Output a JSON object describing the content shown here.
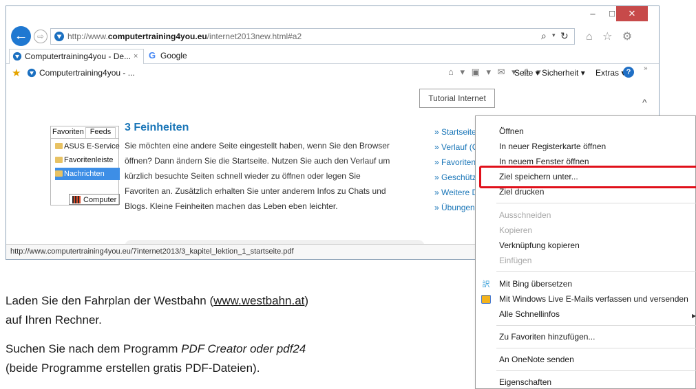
{
  "browser": {
    "window_buttons": {
      "minimize": "–",
      "maximize": "□",
      "close": "✕"
    },
    "back_symbol": "←",
    "forward_symbol": "⇨",
    "address": {
      "url_prefix": "http://www.",
      "url_domain": "computertraining4you.eu",
      "url_path": "/internet2013new.html#a2",
      "search_symbol": "⌕",
      "dropdown_symbol": "▾",
      "refresh_symbol": "↻"
    },
    "toolbar_icons": "⌂ ☆ ⚙",
    "tabs": [
      {
        "label": "Computertraining4you - De...",
        "close": "×"
      },
      {
        "label": "Google",
        "icon_letter": "G"
      }
    ],
    "favorites_bar": {
      "label": "Computertraining4you - ..."
    },
    "command_bar": {
      "icons": "⌂ ▾ ▣ ▾ ✉ ▾ ⎙ ▾",
      "seite": "Seite ▾",
      "sicherheit": "Sicherheit ▾",
      "extras": "Extras ▾",
      "help": "?",
      "more": "»"
    },
    "status_url": "http://www.computertraining4you.eu/7internet2013/3_kapitel_lektion_1_startseite.pdf"
  },
  "page": {
    "tooltip": "Tutorial Internet",
    "scroll_up": "^",
    "favorites_panel": {
      "tabs": [
        "Favoriten",
        "Feeds"
      ],
      "items": [
        "ASUS E-Service",
        "Favoritenleiste",
        "Nachrichten"
      ],
      "pdf_item": "Computer"
    },
    "section_title": "3 Feinheiten",
    "paragraph_lines": [
      "Sie möchten eine andere Seite eingestellt haben, wenn Sie den Browser",
      "öffnen? Dann ändern Sie die Startseite. Nutzen Sie auch den Verlauf um",
      "kürzlich besuchte Seiten schnell wieder zu öffnen oder legen Sie",
      "Favoriten an. Zusätzlich erhalten Sie unter anderem Infos zu Chats und",
      "Blogs. Kleine Feinheiten machen das Leben eben leichter."
    ],
    "side_links": [
      "» Startseite",
      "» Verlauf (C",
      "» Favoriten",
      "» Geschütz",
      "» Weitere D",
      "» Übungen"
    ]
  },
  "context_menu": {
    "items": [
      "Öffnen",
      "In neuer Registerkarte öffnen",
      "In neuem Fenster öffnen",
      "Ziel speichern unter...",
      "Ziel drucken",
      "Ausschneiden",
      "Kopieren",
      "Verknüpfung kopieren",
      "Einfügen",
      "Mit Bing übersetzen",
      "Mit Windows Live E-Mails verfassen und versenden",
      "Alle Schnellinfos",
      "Zu Favoriten hinzufügen...",
      "An OneNote senden",
      "Eigenschaften"
    ],
    "bing_icon": "訳",
    "submenu_arrow": "▶",
    "highlight_color": "#e0101a"
  },
  "instructions": {
    "line1_prefix": "Laden Sie den Fahrplan der Westbahn (",
    "line1_link": "www.westbahn.at",
    "line1_suffix": ")",
    "line2": "auf Ihren Rechner.",
    "line3_prefix": "Suchen Sie nach dem Programm ",
    "line3_italic": "PDF Creator oder pdf24",
    "line4": "(beide Programme erstellen gratis PDF-Dateien)."
  }
}
